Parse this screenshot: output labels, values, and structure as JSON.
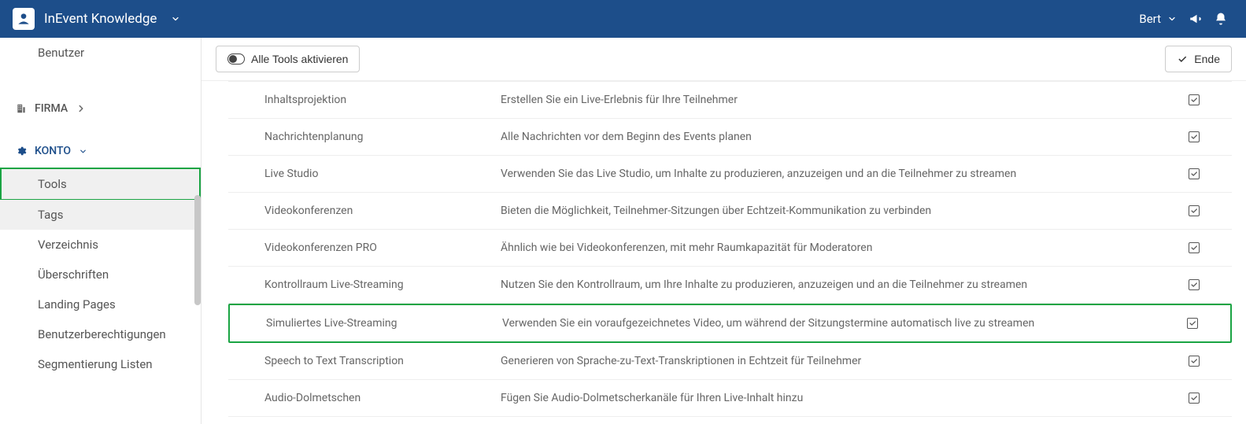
{
  "topbar": {
    "title": "InEvent Knowledge",
    "user": "Bert"
  },
  "sidebar": {
    "benutzer": "Benutzer",
    "firma": "FIRMA",
    "konto": "KONTO",
    "items": {
      "tools": "Tools",
      "tags": "Tags",
      "verzeichnis": "Verzeichnis",
      "ueberschriften": "Überschriften",
      "landing": "Landing Pages",
      "berechtigungen": "Benutzerberechtigungen",
      "segmentierung": "Segmentierung Listen"
    }
  },
  "toolbar": {
    "activate_all": "Alle Tools aktivieren",
    "ende": "Ende"
  },
  "rows": [
    {
      "name": "Inhaltsprojektion",
      "desc": "Erstellen Sie ein Live-Erlebnis für Ihre Teilnehmer"
    },
    {
      "name": "Nachrichtenplanung",
      "desc": "Alle Nachrichten vor dem Beginn des Events planen"
    },
    {
      "name": "Live Studio",
      "desc": "Verwenden Sie das Live Studio, um Inhalte zu produzieren, anzuzeigen und an die Teilnehmer zu streamen"
    },
    {
      "name": "Videokonferenzen",
      "desc": "Bieten die Möglichkeit, Teilnehmer-Sitzungen über Echtzeit-Kommunikation zu verbinden"
    },
    {
      "name": "Videokonferenzen PRO",
      "desc": "Ähnlich wie bei Videokonferenzen, mit mehr Raumkapazität für Moderatoren"
    },
    {
      "name": "Kontrollraum Live-Streaming",
      "desc": "Nutzen Sie den Kontrollraum, um Ihre Inhalte zu produzieren, anzuzeigen und an die Teilnehmer zu streamen"
    },
    {
      "name": "Simuliertes Live-Streaming",
      "desc": "Verwenden Sie ein voraufgezeichnetes Video, um während der Sitzungstermine automatisch live zu streamen"
    },
    {
      "name": "Speech to Text Transcription",
      "desc": "Generieren von Sprache-zu-Text-Transkriptionen in Echtzeit für Teilnehmer"
    },
    {
      "name": "Audio-Dolmetschen",
      "desc": "Fügen Sie Audio-Dolmetscherkanäle für Ihren Live-Inhalt hinzu"
    }
  ]
}
